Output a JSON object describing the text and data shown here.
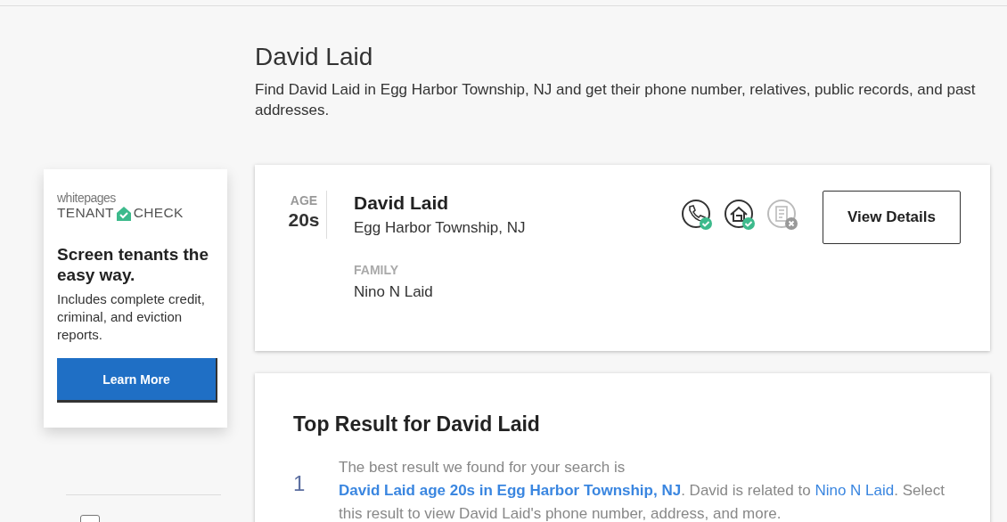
{
  "header": {
    "title": "David Laid",
    "description": "Find David Laid in Egg Harbor Township, NJ and get their phone number, relatives, public records, and past addresses."
  },
  "ad": {
    "brand_top": "whitepages",
    "brand_left": "TENANT",
    "brand_right": "CHECK",
    "headline": "Screen tenants the easy way.",
    "body": "Includes complete credit, criminal, and eviction reports.",
    "button": "Learn More"
  },
  "sidebar_filter": {
    "checked": false
  },
  "result": {
    "age_label": "AGE",
    "age": "20s",
    "name": "David Laid",
    "location": "Egg Harbor Township, NJ",
    "family_label": "FAMILY",
    "family": [
      "Nino N Laid"
    ],
    "records": [
      {
        "kind": "phone",
        "available": true
      },
      {
        "kind": "address",
        "available": true
      },
      {
        "kind": "records",
        "available": false
      }
    ],
    "button": "View Details"
  },
  "top_result": {
    "title": "Top Result for David Laid",
    "index": "1",
    "parts": [
      {
        "kind": "text",
        "text": "The best result we found for your search is "
      },
      {
        "kind": "strong-link",
        "text": "David Laid age 20s in Egg Harbor Township, NJ"
      },
      {
        "kind": "text",
        "text": ". David is related to "
      },
      {
        "kind": "link",
        "text": "Nino N Laid"
      },
      {
        "kind": "text",
        "text": ". Select this result to view David Laid's phone number, address, and more."
      }
    ]
  }
}
